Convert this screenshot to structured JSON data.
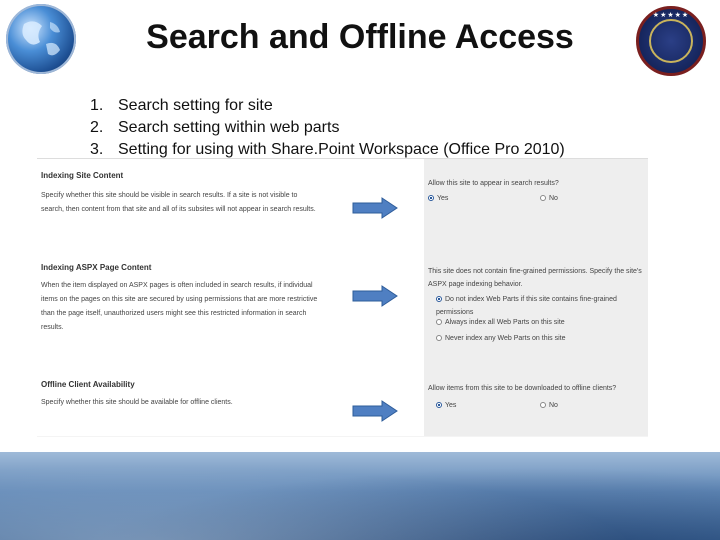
{
  "title": "Search and Offline Access",
  "bullets": [
    {
      "num": "1.",
      "text": "Search setting for site"
    },
    {
      "num": "2.",
      "text": "Search setting within web parts"
    },
    {
      "num": "3.",
      "text": "Setting for using with Share.Point Workspace (Office Pro 2010)"
    }
  ],
  "settings": {
    "indexing_site": {
      "title": "Indexing Site Content",
      "description": "Specify whether this site should be visible in search results. If a site is not visible to search, then content from that site and all of its subsites will not appear in search results.",
      "question": "Allow this site to appear in search results?",
      "options": [
        "Yes",
        "No"
      ],
      "selected": "Yes"
    },
    "indexing_aspx": {
      "title": "Indexing ASPX Page Content",
      "description": "When the item displayed on ASPX pages is often included in search results, if individual items on the pages on this site are secured by using permissions that are more restrictive than the page itself, unauthorized users might see this restricted information in search results.",
      "question": "This site does not contain fine-grained permissions. Specify the site's ASPX page indexing behavior.",
      "options": [
        "Do not index Web Parts if this site contains fine-grained permissions",
        "Always index all Web Parts on this site",
        "Never index any Web Parts on this site"
      ],
      "selected": "Do not index Web Parts if this site contains fine-grained permissions"
    },
    "offline": {
      "title": "Offline Client Availability",
      "description": "Specify whether this site should be available for offline clients.",
      "question": "Allow items from this site to be downloaded to offline clients?",
      "options": [
        "Yes",
        "No"
      ],
      "selected": "Yes"
    }
  },
  "colors": {
    "arrow": "#4f7fc2",
    "arrow_border": "#2e5c9a",
    "footer": "#5f87b6"
  },
  "icons": [
    "globe-logo",
    "seal-logo",
    "right-arrow-icon",
    "radio-icon"
  ]
}
